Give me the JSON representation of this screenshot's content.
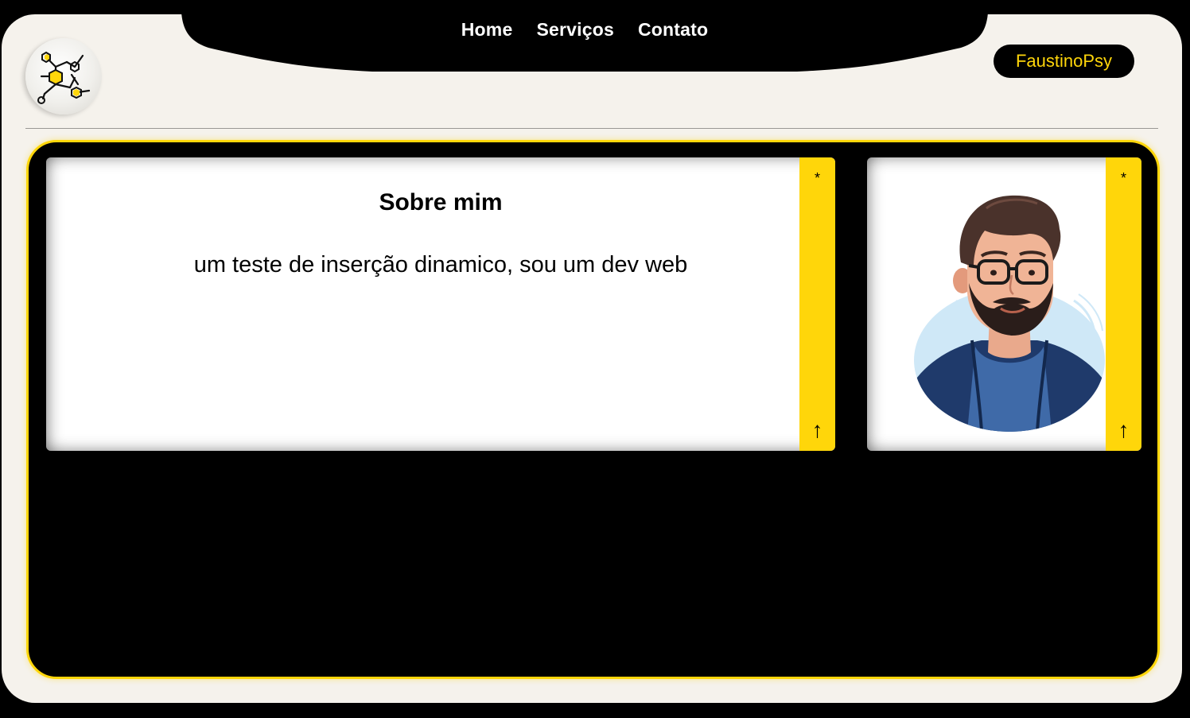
{
  "nav": {
    "items": [
      {
        "label": "Home"
      },
      {
        "label": "Serviços"
      },
      {
        "label": "Contato"
      }
    ]
  },
  "brand": {
    "label": "FaustinoPsy"
  },
  "about": {
    "title": "Sobre mim",
    "text": "um teste de inserção dinamico, sou um dev web"
  },
  "card_strip": {
    "star": "*",
    "arrow": "↑"
  },
  "colors": {
    "accent": "#ffd60a",
    "background": "#f5f2ec",
    "dark": "#000000"
  },
  "icons": {
    "logo": "molecule-icon",
    "avatar": "bearded-man-avatar"
  }
}
